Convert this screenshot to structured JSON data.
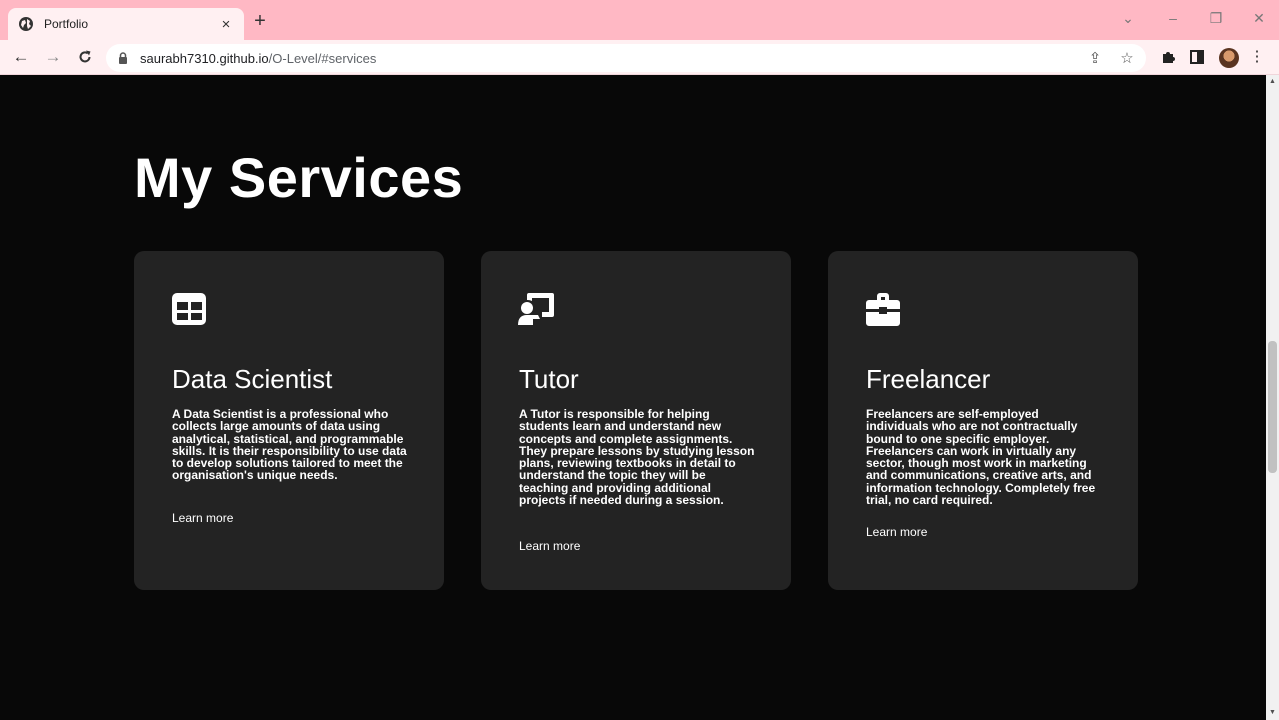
{
  "browser": {
    "tab_title": "Portfolio",
    "url_host": "saurabh7310.github.io",
    "url_path": "/O-Level/#services"
  },
  "page": {
    "heading": "My Services",
    "services": [
      {
        "icon": "table-icon",
        "title": "Data Scientist",
        "description": "A Data Scientist is a professional who collects large amounts of data using analytical, statistical, and programmable skills. It is their responsibility to use data to develop solutions tailored to meet the organisation's unique needs.",
        "link": "Learn more"
      },
      {
        "icon": "chalkboard-teacher-icon",
        "title": "Tutor",
        "description": "A Tutor is responsible for helping students learn and understand new concepts and complete assignments. They prepare lessons by studying lesson plans, reviewing textbooks in detail to understand the topic they will be teaching and providing additional projects if needed during a session.",
        "link": "Learn more"
      },
      {
        "icon": "briefcase-icon",
        "title": "Freelancer",
        "description": "Freelancers are self-employed individuals who are not contractually bound to one specific employer. Freelancers can work in virtually any sector, though most work in marketing and communications, creative arts, and information technology. Completely free trial, no card required.",
        "link": "Learn more"
      }
    ]
  },
  "colors": {
    "background": "#080808",
    "card": "#232323",
    "text": "#ffffff",
    "tabbar": "#ffb8c4"
  }
}
